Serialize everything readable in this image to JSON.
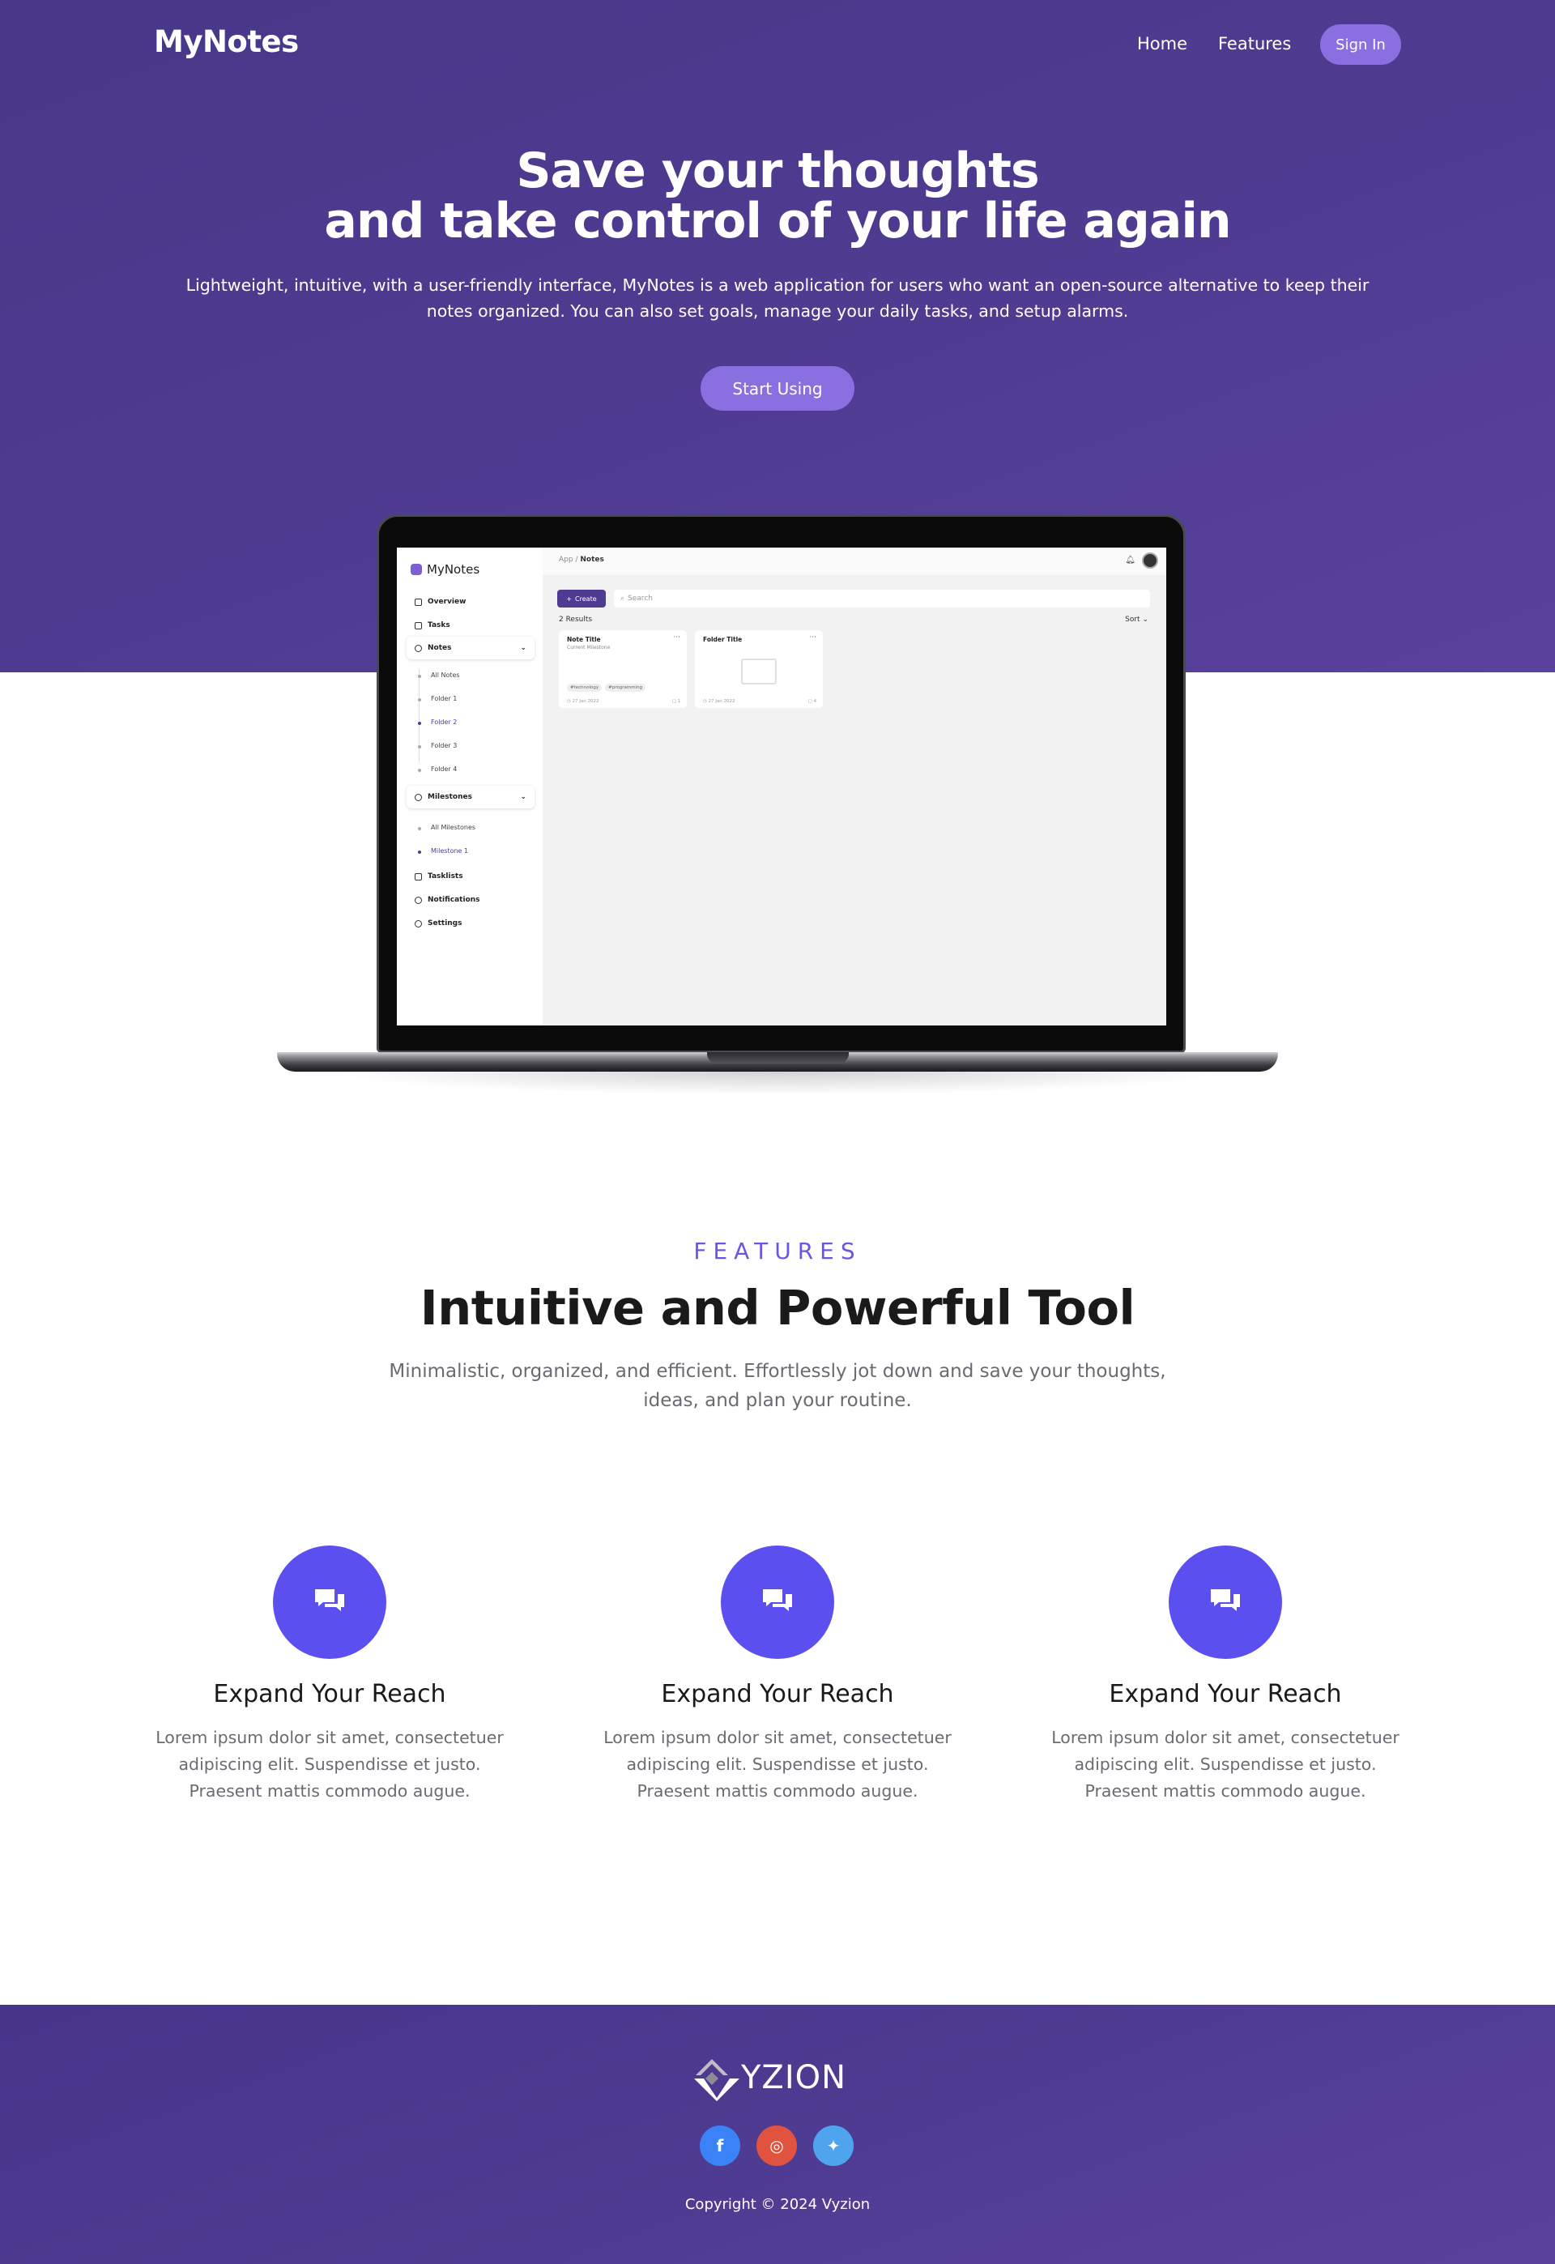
{
  "nav": {
    "brand": "MyNotes",
    "home": "Home",
    "features": "Features",
    "sign_in": "Sign In"
  },
  "hero": {
    "title_line1": "Save your thoughts",
    "title_line2": "and take control of your life again",
    "description": "Lightweight, intuitive, with a user-friendly interface, MyNotes is a web application for users who want an open-source alternative to keep their notes organized. You can also set goals, manage your daily tasks, and setup alarms.",
    "cta": "Start Using"
  },
  "preview": {
    "brand": "MyNotes",
    "breadcrumb_root": "App /",
    "breadcrumb_current": "Notes",
    "sidebar": {
      "overview": "Overview",
      "tasks": "Tasks",
      "notes": "Notes",
      "notes_children": [
        "All Notes",
        "Folder 1",
        "Folder 2",
        "Folder 3",
        "Folder 4"
      ],
      "milestones": "Milestones",
      "milestones_children": [
        "All Milestones",
        "Milestone 1"
      ],
      "tasklists": "Tasklists",
      "notifications": "Notifications",
      "settings": "Settings"
    },
    "create": "Create",
    "search_placeholder": "Search",
    "results": "2 Results",
    "sort": "Sort",
    "cards": [
      {
        "title": "Note Title",
        "subtitle": "Current Milestone",
        "tags": [
          "#technology",
          "#programming"
        ],
        "date": "27 Jan 2022",
        "count": "1"
      },
      {
        "title": "Folder Title",
        "date": "27 Jan 2022",
        "count": "4"
      }
    ]
  },
  "features": {
    "kicker": "FEATURES",
    "title": "Intuitive and Powerful Tool",
    "description": "Minimalistic, organized, and efficient. Effortlessly jot down and save your thoughts, ideas, and plan your routine.",
    "items": [
      {
        "icon": "chat-bubbles-icon",
        "title": "Expand Your Reach",
        "text": "Lorem ipsum dolor sit amet, consectetuer adipiscing elit. Suspendisse et justo. Praesent mattis commodo augue."
      },
      {
        "icon": "chat-bubbles-icon",
        "title": "Expand Your Reach",
        "text": "Lorem ipsum dolor sit amet, consectetuer adipiscing elit. Suspendisse et justo. Praesent mattis commodo augue."
      },
      {
        "icon": "chat-bubbles-icon",
        "title": "Expand Your Reach",
        "text": "Lorem ipsum dolor sit amet, consectetuer adipiscing elit. Suspendisse et justo. Praesent mattis commodo augue."
      }
    ]
  },
  "footer": {
    "logo_text": "YZION",
    "social": [
      {
        "icon": "facebook-icon",
        "glyph": "f",
        "color": "#3b82f6"
      },
      {
        "icon": "instagram-icon",
        "glyph": "◎",
        "color": "#e0533f"
      },
      {
        "icon": "twitter-icon",
        "glyph": "✦",
        "color": "#4ea5ee"
      }
    ],
    "copyright": "Copyright © 2024 Vyzion"
  },
  "colors": {
    "hero_bg": "#4f3c92",
    "accent": "#8a6fe0",
    "feature_icon_bg": "#5b4ff0",
    "kicker": "#6c55e2"
  }
}
